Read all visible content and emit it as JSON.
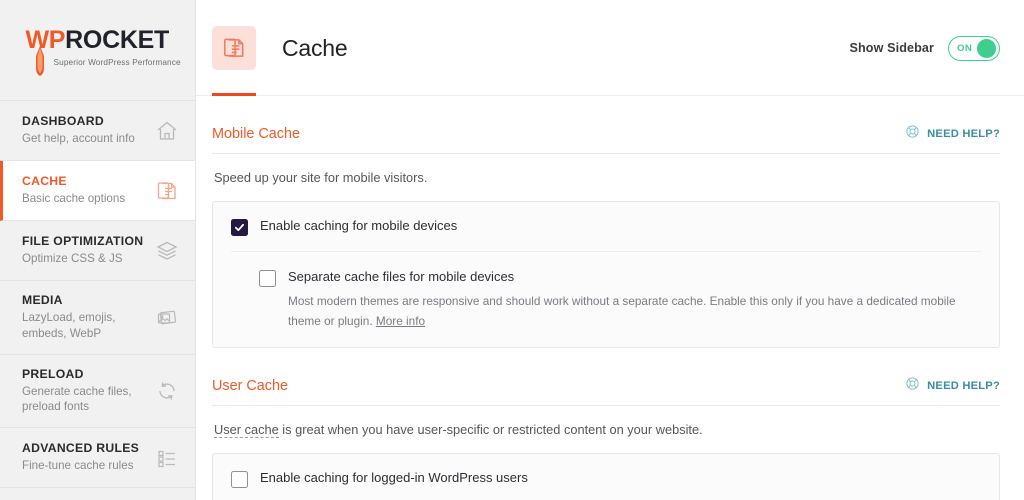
{
  "brand": {
    "name_part1": "WP",
    "name_part2": "ROCKET",
    "tagline": "Superior WordPress Performance",
    "orange": "#f05a28",
    "navy": "#21222c"
  },
  "sidebar": {
    "items": [
      {
        "title": "DASHBOARD",
        "subtitle": "Get help, account info",
        "icon": "home-icon",
        "active": false
      },
      {
        "title": "CACHE",
        "subtitle": "Basic cache options",
        "icon": "document-stack-icon",
        "active": true
      },
      {
        "title": "FILE OPTIMIZATION",
        "subtitle": "Optimize CSS & JS",
        "icon": "layers-icon",
        "active": false
      },
      {
        "title": "MEDIA",
        "subtitle": "LazyLoad, emojis, embeds, WebP",
        "icon": "photos-icon",
        "active": false
      },
      {
        "title": "PRELOAD",
        "subtitle": "Generate cache files, preload fonts",
        "icon": "refresh-icon",
        "active": false
      },
      {
        "title": "ADVANCED RULES",
        "subtitle": "Fine-tune cache rules",
        "icon": "checklist-icon",
        "active": false
      }
    ]
  },
  "header": {
    "title": "Cache",
    "icon": "document-stack-icon",
    "sidebar_toggle_label": "Show Sidebar",
    "toggle_state": "ON",
    "toggle_color": "#3ecf8e",
    "accent_underline": "#f0461e"
  },
  "sections": [
    {
      "title": "Mobile Cache",
      "need_help": "NEED HELP?",
      "need_help_icon": "lifebuoy-icon",
      "description": "Speed up your site for mobile visitors.",
      "options": [
        {
          "label": "Enable caching for mobile devices",
          "checked": true
        }
      ],
      "sub_option": {
        "label": "Separate cache files for mobile devices",
        "checked": false,
        "description": "Most modern themes are responsive and should work without a separate cache. Enable this only if you have a dedicated mobile theme or plugin.",
        "link_text": "More info"
      }
    },
    {
      "title": "User Cache",
      "need_help": "NEED HELP?",
      "need_help_icon": "lifebuoy-icon",
      "description_link": "User cache",
      "description_rest": " is great when you have user-specific or restricted content on your website.",
      "options": [
        {
          "label": "Enable caching for logged-in WordPress users",
          "checked": false
        }
      ]
    }
  ]
}
